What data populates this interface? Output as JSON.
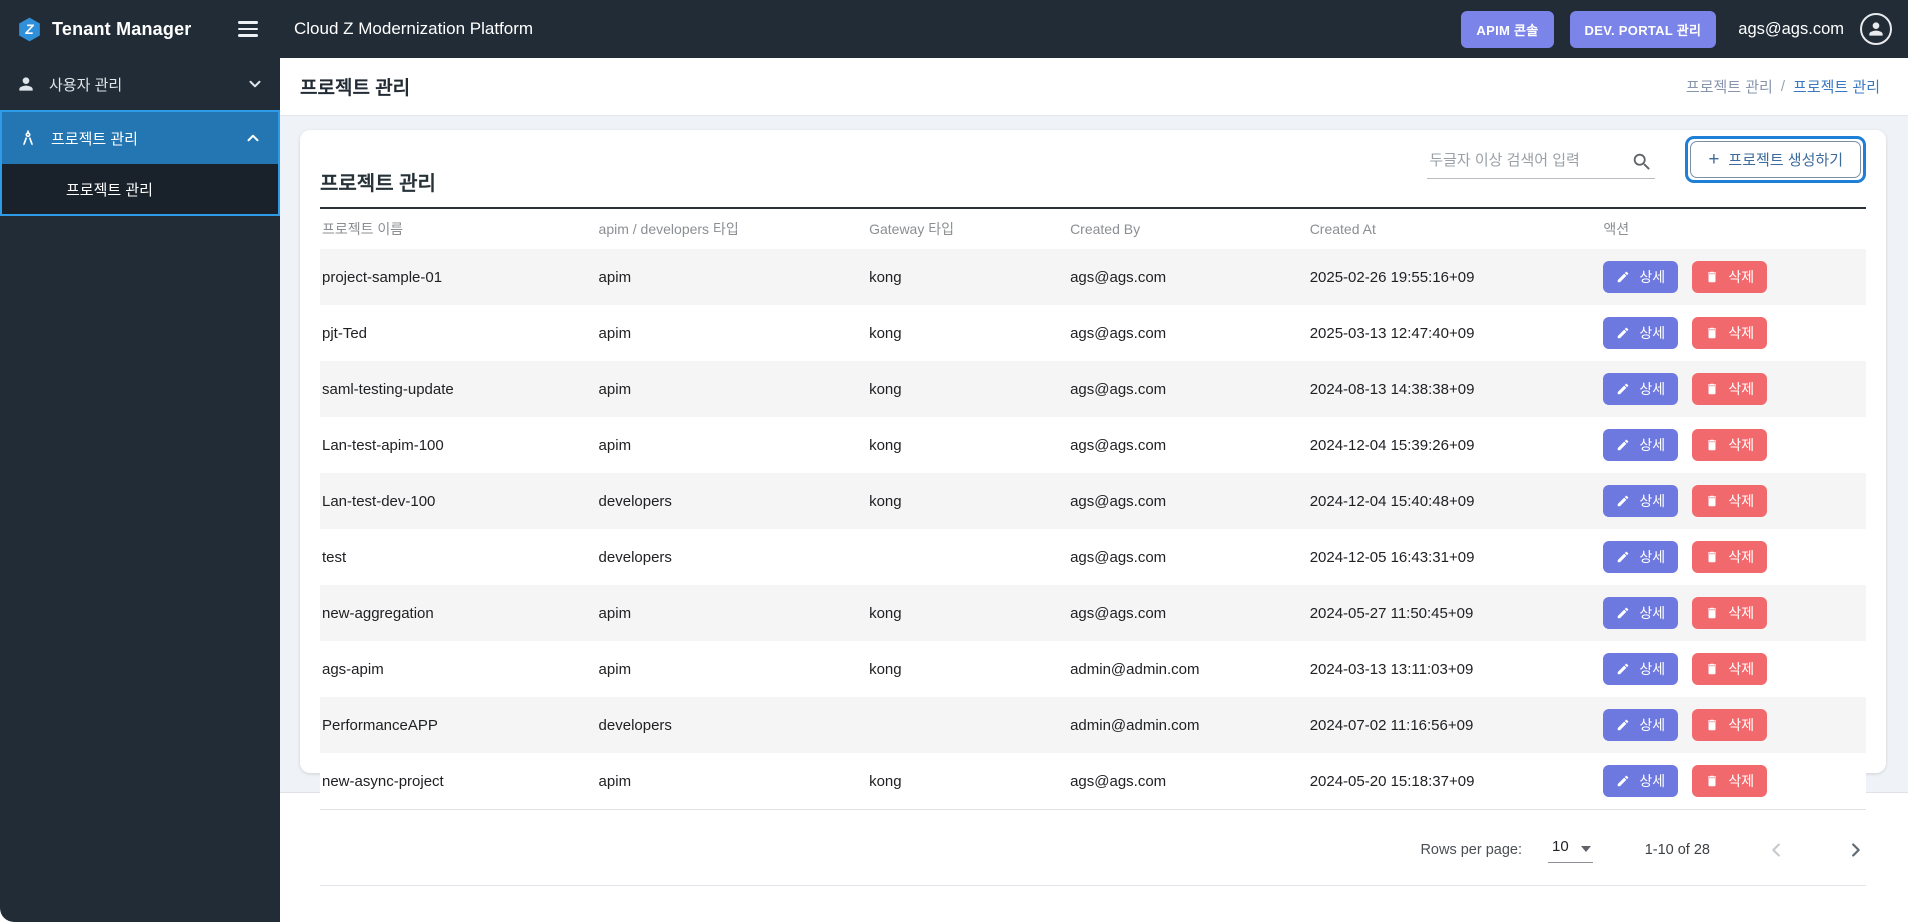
{
  "header": {
    "brand": "Tenant Manager",
    "app_title": "Cloud Z Modernization Platform",
    "buttons": {
      "apim": "APIM 콘솔",
      "dev_portal": "DEV. PORTAL 관리"
    },
    "user_email": "ags@ags.com"
  },
  "sidebar": {
    "items": [
      {
        "label": "사용자 관리",
        "icon": "person",
        "state": "collapsed"
      },
      {
        "label": "프로젝트 관리",
        "icon": "architecture",
        "state": "expanded",
        "children": [
          {
            "label": "프로젝트 관리"
          }
        ]
      }
    ]
  },
  "page": {
    "title": "프로젝트 관리",
    "breadcrumb": {
      "parent": "프로젝트 관리",
      "separator": "/",
      "current": "프로젝트 관리"
    }
  },
  "card": {
    "title": "프로젝트 관리",
    "search_placeholder": "두글자 이상 검색어 입력",
    "create_plus": "+",
    "create_label": "프로젝트 생성하기"
  },
  "table": {
    "columns": [
      "프로젝트 이름",
      "apim / developers 타입",
      "Gateway 타입",
      "Created By",
      "Created At",
      "액션"
    ],
    "action_labels": {
      "detail": "상세",
      "delete": "삭제"
    },
    "rows": [
      {
        "name": "project-sample-01",
        "type": "apim",
        "gateway": "kong",
        "created_by": "ags@ags.com",
        "created_at": "2025-02-26 19:55:16+09"
      },
      {
        "name": "pjt-Ted",
        "type": "apim",
        "gateway": "kong",
        "created_by": "ags@ags.com",
        "created_at": "2025-03-13 12:47:40+09"
      },
      {
        "name": "saml-testing-update",
        "type": "apim",
        "gateway": "kong",
        "created_by": "ags@ags.com",
        "created_at": "2024-08-13 14:38:38+09"
      },
      {
        "name": "Lan-test-apim-100",
        "type": "apim",
        "gateway": "kong",
        "created_by": "ags@ags.com",
        "created_at": "2024-12-04 15:39:26+09"
      },
      {
        "name": "Lan-test-dev-100",
        "type": "developers",
        "gateway": "kong",
        "created_by": "ags@ags.com",
        "created_at": "2024-12-04 15:40:48+09"
      },
      {
        "name": "test",
        "type": "developers",
        "gateway": "",
        "created_by": "ags@ags.com",
        "created_at": "2024-12-05 16:43:31+09"
      },
      {
        "name": "new-aggregation",
        "type": "apim",
        "gateway": "kong",
        "created_by": "ags@ags.com",
        "created_at": "2024-05-27 11:50:45+09"
      },
      {
        "name": "ags-apim",
        "type": "apim",
        "gateway": "kong",
        "created_by": "admin@admin.com",
        "created_at": "2024-03-13 13:11:03+09"
      },
      {
        "name": "PerformanceAPP",
        "type": "developers",
        "gateway": "",
        "created_by": "admin@admin.com",
        "created_at": "2024-07-02 11:16:56+09"
      },
      {
        "name": "new-async-project",
        "type": "apim",
        "gateway": "kong",
        "created_by": "ags@ags.com",
        "created_at": "2024-05-20 15:18:37+09"
      }
    ]
  },
  "pagination": {
    "rows_per_page_label": "Rows per page:",
    "rows_per_page_value": "10",
    "range": "1-10 of 28"
  },
  "icons": {
    "menu": "hamburger",
    "search": "magnifier",
    "user_item": "person",
    "project_item": "drafting-compass",
    "chevron_collapsed": "chevron-down",
    "chevron_expanded": "chevron-up",
    "detail": "pencil",
    "delete": "trash",
    "avatar": "person-circle",
    "page_prev": "chevron-left",
    "page_next": "chevron-right",
    "rows_select": "caret-down"
  },
  "colors": {
    "header_bg": "#212c36",
    "sidebar_selected_bg": "#2476b2",
    "sidebar_selected_border": "#2e9be8",
    "nav_button_bg": "#7b84e8",
    "detail_button_bg": "#6e79e0",
    "delete_button_bg": "#f1696c",
    "create_button_ring": "#1d7fd6",
    "create_button_text": "#3d6b9c",
    "breadcrumb_current": "#3b79c2",
    "breadcrumb_parent": "#8796ad",
    "row_alt_bg": "#f5f5f5",
    "content_bg": "#eff2f6"
  }
}
